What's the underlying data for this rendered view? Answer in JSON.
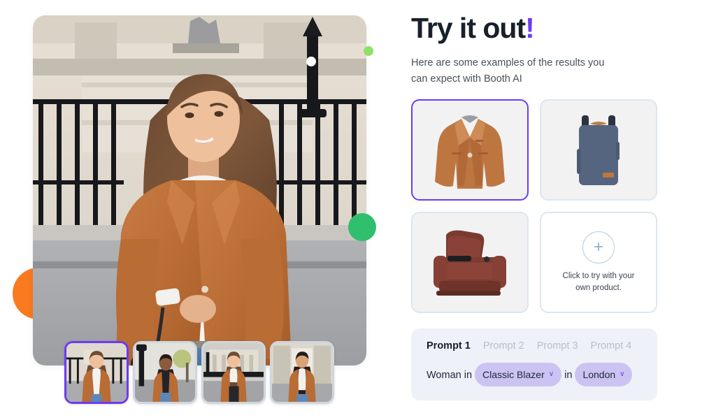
{
  "header": {
    "title_main": "Try it out",
    "title_bang": "!",
    "subtitle": "Here are some examples of the results you can expect with Booth AI"
  },
  "hero": {
    "alt": "Woman in tan classic blazer, white shirt and blue jeans standing in front of an iron fence in London",
    "selected_thumbnail_index": 0
  },
  "thumbnails": [
    {
      "alt": "Woman in tan blazer in front of iron fence",
      "selected": true
    },
    {
      "alt": "Woman in tan blazer on London street with lamppost",
      "selected": false
    },
    {
      "alt": "Woman in tan blazer in front of Buckingham Palace",
      "selected": false
    },
    {
      "alt": "Woman in tan blazer in front of columned building",
      "selected": false
    }
  ],
  "products": [
    {
      "name": "classic-blazer",
      "label": "Classic Blazer",
      "selected": true
    },
    {
      "name": "backpack",
      "label": "Backpack",
      "selected": false
    },
    {
      "name": "recliner",
      "label": "Leather Recliner",
      "selected": false
    }
  ],
  "add_product_card": {
    "icon": "plus-icon",
    "label": "Click to try with your own product."
  },
  "prompt_panel": {
    "tabs": [
      {
        "label": "Prompt 1",
        "active": true
      },
      {
        "label": "Prompt 2",
        "active": false
      },
      {
        "label": "Prompt 3",
        "active": false
      },
      {
        "label": "Prompt 4",
        "active": false
      }
    ],
    "text_before": "Woman in",
    "product_pill": "Classic Blazer",
    "text_middle": "in",
    "location_pill": "London",
    "chevron": "∨"
  },
  "colors": {
    "accent_purple": "#6C3BF4",
    "pill_lavender": "#CBC3F2",
    "panel_bg": "#EEF1F8",
    "card_border": "#DCE6EE",
    "blob_orange": "#F97A1F",
    "blob_green": "#2FBF6E",
    "blob_green_light": "#8FE06B"
  }
}
